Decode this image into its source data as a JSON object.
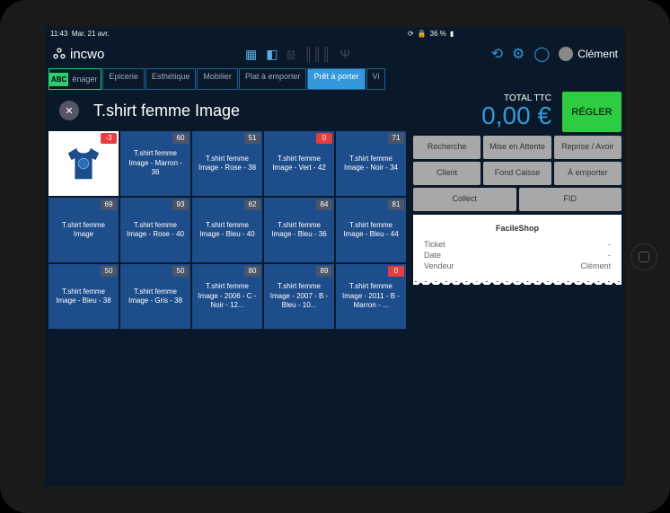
{
  "statusbar": {
    "time": "11:43",
    "date": "Mar. 21 avr.",
    "battery": "36 %"
  },
  "brand": "incwo",
  "user": {
    "name": "Clément"
  },
  "tabs": [
    {
      "label": "énager",
      "abc": "ABC"
    },
    {
      "label": "Epicerie"
    },
    {
      "label": "Esthétique"
    },
    {
      "label": "Mobilier"
    },
    {
      "label": "Plat à emporter"
    },
    {
      "label": "Prêt à porter",
      "active": true
    },
    {
      "label": "Vi"
    }
  ],
  "category": "T.shirt femme Image",
  "tiles": [
    {
      "label": "",
      "badge": "-3",
      "badgeColor": "red",
      "isImage": true
    },
    {
      "label": "T.shirt femme Image - Marron - 36",
      "badge": "60",
      "badgeColor": "grey"
    },
    {
      "label": "T.shirt femme Image - Rose - 38",
      "badge": "51",
      "badgeColor": "grey"
    },
    {
      "label": "T.shirt femme Image - Vert - 42",
      "badge": "0",
      "badgeColor": "red"
    },
    {
      "label": "T.shirt femme Image - Noir - 34",
      "badge": "71",
      "badgeColor": "grey"
    },
    {
      "label": "T.shirt femme Image",
      "badge": "69",
      "badgeColor": "grey"
    },
    {
      "label": "T.shirt femme Image - Rose - 40",
      "badge": "93",
      "badgeColor": "grey"
    },
    {
      "label": "T.shirt femme Image - Bleu - 40",
      "badge": "62",
      "badgeColor": "grey"
    },
    {
      "label": "T.shirt femme Image - Bleu - 36",
      "badge": "84",
      "badgeColor": "grey"
    },
    {
      "label": "T.shirt femme Image - Bleu - 44",
      "badge": "81",
      "badgeColor": "grey"
    },
    {
      "label": "T.shirt femme Image - Bleu - 38",
      "badge": "50",
      "badgeColor": "grey"
    },
    {
      "label": "T.shirt femme Image - Gris - 38",
      "badge": "50",
      "badgeColor": "grey"
    },
    {
      "label": "T.shirt femme Image - 2006 - C - Noir - 12...",
      "badge": "80",
      "badgeColor": "grey"
    },
    {
      "label": "T.shirt femme Image - 2007 - B - Bleu - 10...",
      "badge": "89",
      "badgeColor": "grey"
    },
    {
      "label": "T.shirt femme Image - 2011 - B - Marron - ...",
      "badge": "0",
      "badgeColor": "red"
    }
  ],
  "total": {
    "label": "TOTAL TTC",
    "amount": "0,00 €"
  },
  "pay_label": "RÉGLER",
  "actions": {
    "row1": [
      "Recherche",
      "Mise en Attente",
      "Reprise / Avoir"
    ],
    "row2": [
      "Client",
      "Fond Caisse",
      "À emporter"
    ],
    "row3": [
      "Collect",
      "FID"
    ]
  },
  "receipt": {
    "shop": "FacileShop",
    "lines": [
      {
        "k": "Ticket",
        "v": "-"
      },
      {
        "k": "Date",
        "v": "-"
      },
      {
        "k": "Vendeur",
        "v": "Clément"
      }
    ]
  }
}
